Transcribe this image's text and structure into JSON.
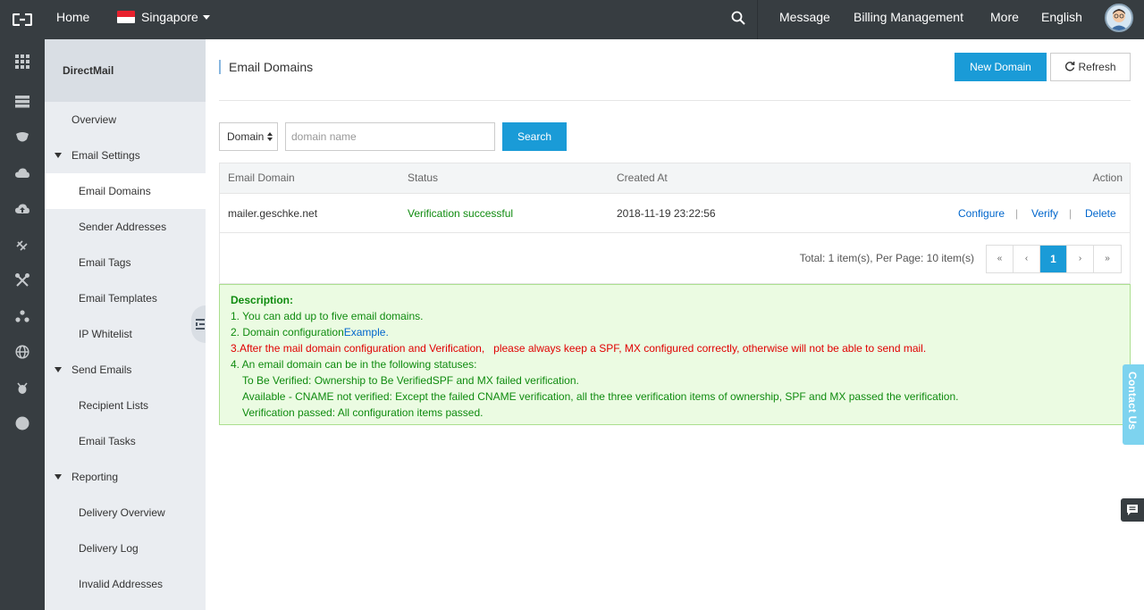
{
  "topbar": {
    "home": "Home",
    "region": "Singapore",
    "nav": [
      "Message",
      "Billing Management",
      "More",
      "English"
    ]
  },
  "sidebar": {
    "title": "DirectMail",
    "items": [
      {
        "label": "Overview",
        "level": 1
      },
      {
        "label": "Email Settings",
        "level": 1,
        "group": true
      },
      {
        "label": "Email Domains",
        "level": 2,
        "active": true
      },
      {
        "label": "Sender Addresses",
        "level": 2
      },
      {
        "label": "Email Tags",
        "level": 2
      },
      {
        "label": "Email Templates",
        "level": 2
      },
      {
        "label": "IP Whitelist",
        "level": 2
      },
      {
        "label": "Send Emails",
        "level": 1,
        "group": true
      },
      {
        "label": "Recipient Lists",
        "level": 2
      },
      {
        "label": "Email Tasks",
        "level": 2
      },
      {
        "label": "Reporting",
        "level": 1,
        "group": true
      },
      {
        "label": "Delivery Overview",
        "level": 2
      },
      {
        "label": "Delivery Log",
        "level": 2
      },
      {
        "label": "Invalid Addresses",
        "level": 2
      }
    ]
  },
  "main": {
    "title": "Email Domains",
    "new_domain": "New Domain",
    "refresh": "Refresh",
    "filter_select": "Domain",
    "search_placeholder": "domain name",
    "search_button": "Search"
  },
  "table": {
    "headers": [
      "Email Domain",
      "Status",
      "Created At",
      "Action"
    ],
    "rows": [
      {
        "domain": "mailer.geschke.net",
        "status": "Verification successful",
        "created": "2018-11-19 23:22:56",
        "actions": [
          "Configure",
          "Verify",
          "Delete"
        ]
      }
    ],
    "pager_text": "Total: 1 item(s), Per Page: 10 item(s)",
    "pages": [
      "«",
      "‹",
      "1",
      "›",
      "»"
    ]
  },
  "description": {
    "title": "Description:",
    "line1": "1. You can add up to five email domains.",
    "line2_prefix": "2. Domain configuration",
    "line2_link": "Example.",
    "line3": "3.After the mail domain configuration and Verification,   please always keep a SPF, MX configured correctly, otherwise will not be able to send mail.",
    "line4": "4. An email domain can be in the following statuses:",
    "line4a": "To Be Verified: Ownership to Be VerifiedSPF and MX failed verification.",
    "line4b": "Available - CNAME not verified: Except the failed CNAME verification, all the three verification items of ownership, SPF and MX passed the verification.",
    "line4c": "Verification passed: All configuration items passed."
  },
  "contact_us": "Contact Us",
  "colors": {
    "topbar": "#373d41",
    "primary": "#1a9bd7",
    "success": "#0f8b0f",
    "alert": "#e00000",
    "link": "#0066cc"
  }
}
